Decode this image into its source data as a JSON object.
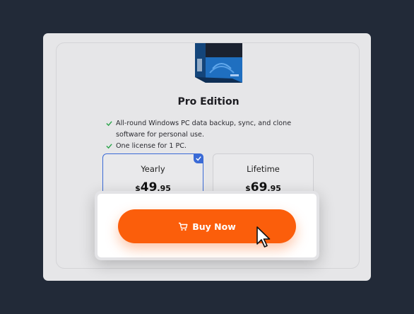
{
  "product": {
    "title": "Pro Edition",
    "features": [
      "All-round Windows PC data backup, sync, and clone software for personal use.",
      "One license for 1 PC."
    ]
  },
  "plans": [
    {
      "name": "Yearly",
      "currency": "$",
      "price_int": "49",
      "price_dec": ".95",
      "selected": true
    },
    {
      "name": "Lifetime",
      "currency": "$",
      "price_int": "69",
      "price_dec": ".95",
      "selected": false
    }
  ],
  "cta": {
    "label": "Buy Now",
    "icon": "cart-icon"
  },
  "colors": {
    "background": "#222a38",
    "accent": "#fb5e0b",
    "selected_border": "#3a6ad6",
    "check": "#2aa44a"
  }
}
